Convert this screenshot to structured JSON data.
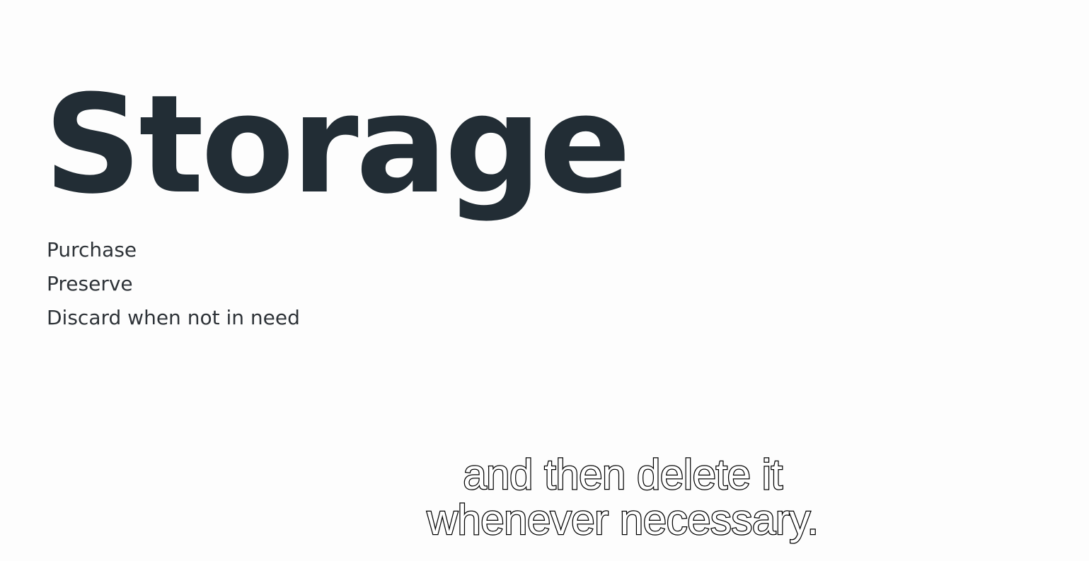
{
  "slide": {
    "title": "Storage",
    "bullets": [
      "Purchase",
      "Preserve",
      "Discard when not in need"
    ]
  },
  "subtitle": {
    "lines": [
      "and then delete it",
      "whenever necessary."
    ]
  }
}
